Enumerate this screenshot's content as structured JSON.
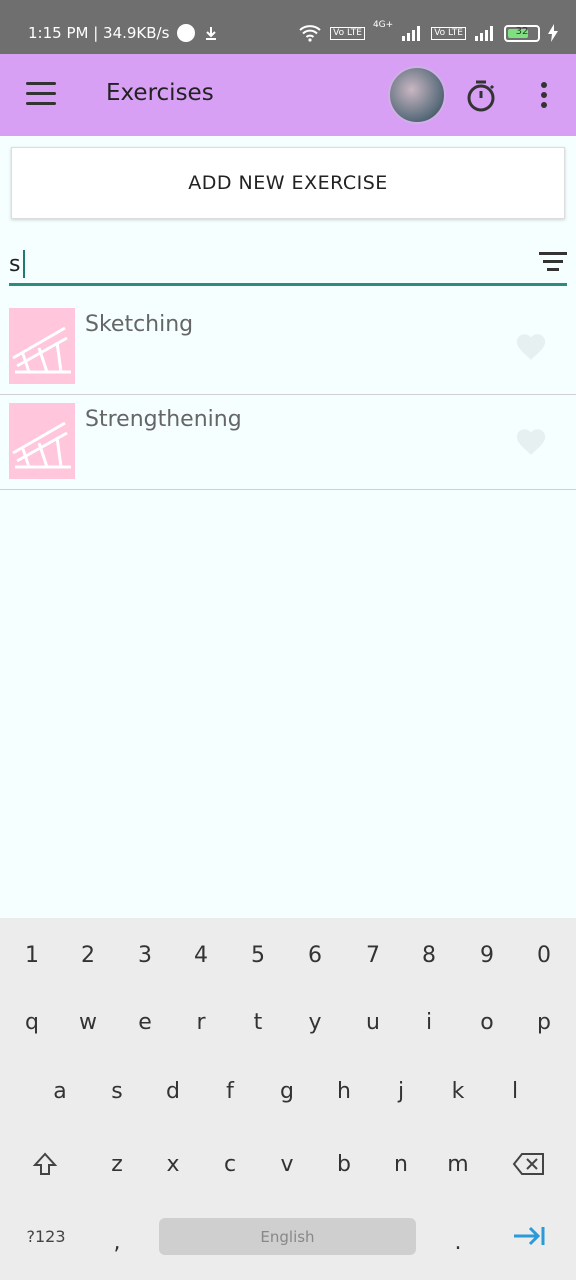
{
  "status_bar": {
    "time_speed": "1:15 PM | 34.9KB/s",
    "network_label": "4G+",
    "volte_1": "Vo LTE",
    "volte_2": "Vo LTE",
    "battery": "32"
  },
  "app_bar": {
    "title": "Exercises",
    "menu_icon": "hamburger-menu-icon",
    "timer_icon": "stopwatch-icon",
    "more_icon": "more-vert-icon",
    "color": "#d7a0f5"
  },
  "add_button": {
    "label": "ADD NEW EXERCISE"
  },
  "search": {
    "value": "s",
    "placeholder": "",
    "filter_icon": "filter-icon",
    "accent": "#2e8b7f"
  },
  "exercises": [
    {
      "name": "Sketching",
      "thumb_color": "#ffc6dc",
      "fav_icon": "favorite-icon"
    },
    {
      "name": "Strengthening",
      "thumb_color": "#ffc6dc",
      "fav_icon": "favorite-icon"
    }
  ],
  "keyboard": {
    "row_numbers": [
      "1",
      "2",
      "3",
      "4",
      "5",
      "6",
      "7",
      "8",
      "9",
      "0"
    ],
    "row_1": [
      "q",
      "w",
      "e",
      "r",
      "t",
      "y",
      "u",
      "i",
      "o",
      "p"
    ],
    "row_2": [
      "a",
      "s",
      "d",
      "f",
      "g",
      "h",
      "j",
      "k",
      "l"
    ],
    "row_3": [
      "z",
      "x",
      "c",
      "v",
      "b",
      "n",
      "m"
    ],
    "symbols": "?123",
    "comma": ",",
    "space": "English",
    "period": ".",
    "enter_icon": "tab-arrow-icon",
    "shift_icon": "shift-arrow-icon",
    "backspace_icon": "backspace-icon"
  }
}
